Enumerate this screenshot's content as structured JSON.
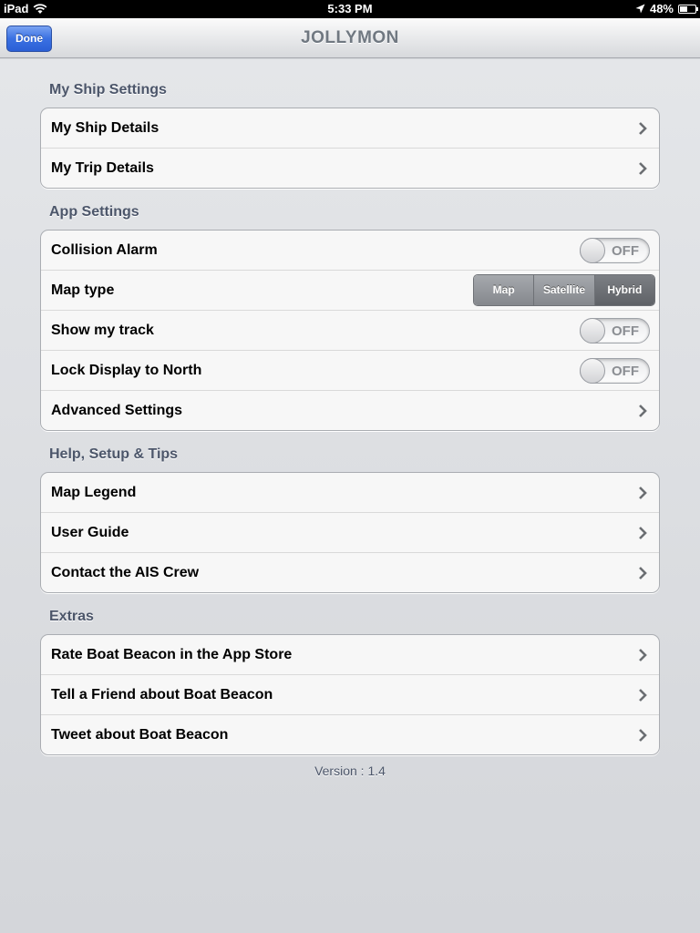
{
  "status_bar": {
    "device": "iPad",
    "time": "5:33 PM",
    "battery": "48%",
    "battery_level": 0.48
  },
  "nav": {
    "title": "JOLLYMON",
    "done_label": "Done"
  },
  "sections": [
    {
      "header": "My Ship Settings",
      "rows": [
        {
          "label": "My Ship Details"
        },
        {
          "label": "My Trip Details"
        }
      ]
    },
    {
      "header": "App Settings",
      "rows": [
        {
          "label": "Collision Alarm",
          "toggle": "OFF"
        },
        {
          "label": "Map type",
          "segments": [
            "Map",
            "Satellite",
            "Hybrid"
          ],
          "selected": "Hybrid"
        },
        {
          "label": "Show my track",
          "toggle": "OFF"
        },
        {
          "label": "Lock Display to North",
          "toggle": "OFF"
        },
        {
          "label": "Advanced Settings"
        }
      ]
    },
    {
      "header": "Help, Setup & Tips",
      "rows": [
        {
          "label": "Map Legend"
        },
        {
          "label": "User Guide"
        },
        {
          "label": "Contact the AIS Crew"
        }
      ]
    },
    {
      "header": "Extras",
      "rows": [
        {
          "label": "Rate Boat Beacon in the App Store"
        },
        {
          "label": "Tell a Friend about Boat Beacon"
        },
        {
          "label": "Tweet about Boat Beacon"
        }
      ]
    }
  ],
  "version": "Version : 1.4"
}
